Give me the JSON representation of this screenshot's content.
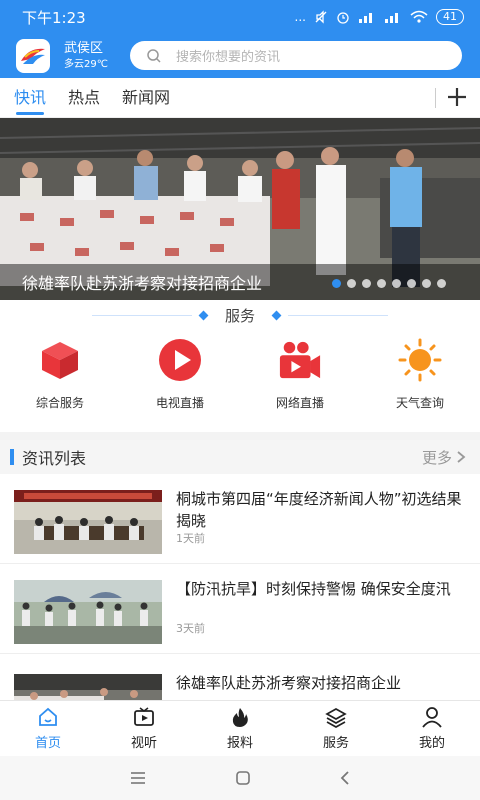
{
  "status": {
    "time": "下午1:23",
    "signal": "...",
    "battery": "41"
  },
  "header": {
    "district": "武侯区",
    "weather": "多云29℃"
  },
  "search": {
    "placeholder": "搜索你想要的资讯"
  },
  "tabs": [
    {
      "label": "快讯"
    },
    {
      "label": "热点"
    },
    {
      "label": "新闻网"
    }
  ],
  "banner": {
    "caption": "徐雄率队赴苏浙考察对接招商企业",
    "slide_index": 1,
    "slide_count": 8
  },
  "services": {
    "title": "服务",
    "items": [
      {
        "label": "综合服务",
        "icon": "cube-icon"
      },
      {
        "label": "电视直播",
        "icon": "play-icon"
      },
      {
        "label": "网络直播",
        "icon": "camera-icon"
      },
      {
        "label": "天气查询",
        "icon": "sun-icon"
      }
    ]
  },
  "news_list": {
    "title": "资讯列表",
    "more": "更多",
    "items": [
      {
        "title": "桐城市第四届“年度经济新闻人物”初选结果揭晓",
        "time": "1天前"
      },
      {
        "title": "【防汛抗旱】时刻保持警惕 确保安全度汛",
        "time": "3天前"
      },
      {
        "title": "徐雄率队赴苏浙考察对接招商企业",
        "time": ""
      }
    ]
  },
  "bottom_nav": [
    {
      "label": "首页",
      "active": true
    },
    {
      "label": "视听"
    },
    {
      "label": "报料"
    },
    {
      "label": "服务"
    },
    {
      "label": "我的"
    }
  ],
  "colors": {
    "brand": "#2f8ef0",
    "service_red": "#e8353a",
    "weather_orange": "#f7941d"
  }
}
